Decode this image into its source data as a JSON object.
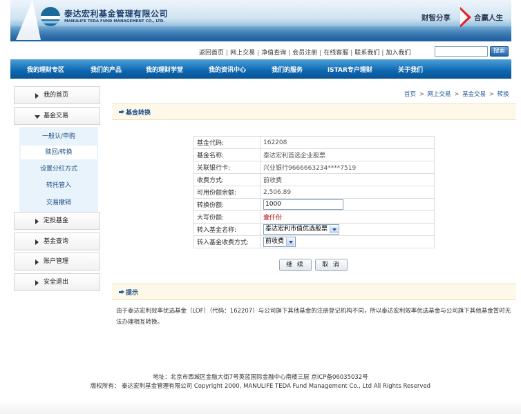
{
  "header": {
    "logo_cn": "泰达宏利基金管理有限公司",
    "logo_en": "MANULIFE TEDA FUND MANAGEMENT CO., LTD.",
    "slogan_left": "财智分享",
    "slogan_right": "合赢人生"
  },
  "toplinks": [
    "返回首页",
    "网上交易",
    "净值查询",
    "会员注册",
    "在线客服",
    "联系我们",
    "加入我们"
  ],
  "search": {
    "button": "搜索",
    "value": ""
  },
  "nav": [
    "我的理财专区",
    "我们的产品",
    "我的理财学堂",
    "我的资讯中心",
    "我们的服务",
    "iSTAR专户理财",
    "关于我们"
  ],
  "sidebar": {
    "items": [
      "我的首页",
      "基金交易",
      "定投基金",
      "基金查询",
      "账户管理",
      "安全退出"
    ],
    "sub_items": [
      "一般认/申购",
      "赎回/转换",
      "设置分红方式",
      "转托管入",
      "交易撤销"
    ]
  },
  "breadcrumb": [
    "首页",
    "网上交易",
    "基金交易",
    "转换"
  ],
  "section1_title": "基金转换",
  "form": {
    "rows": [
      {
        "label": "基金代码:",
        "value": "162208"
      },
      {
        "label": "基金名称:",
        "value": "泰达宏利首选企业股票"
      },
      {
        "label": "关联银行卡:",
        "value": "兴业银行9666663234****7519"
      },
      {
        "label": "收费方式:",
        "value": "前收费"
      },
      {
        "label": "可用份额余额:",
        "value": "2,506.89"
      },
      {
        "label": "转换份额:",
        "value": "1000"
      },
      {
        "label": "大写份额:",
        "value": "壹仟份"
      },
      {
        "label": "转入基金名称:",
        "value": "泰达宏利市值优选股票"
      },
      {
        "label": "转入基金收费方式:",
        "value": "前收费"
      }
    ]
  },
  "buttons": {
    "continue": "继 续",
    "cancel": "取 消"
  },
  "section2_title": "提示",
  "note": "由于泰达宏利效率优选基金（LOF）（代码：162207）与公司旗下其他基金的注册登记机构不同，所以泰达宏利效率优选基金与公司旗下其他基金暂时无法办理相互转换。",
  "footer": {
    "address": "地址：北京市西城区金融大街7号英蓝国际金融中心南楼三层 京ICP备06035032号",
    "copyright": "版权所有：  泰达宏利基金管理有限公司 Copyright 2000, MANULIFE TEDA Fund Management Co., Ltd All Rights Reserved"
  },
  "colors": {
    "nav_blue": "#0d66b0",
    "section_bg": "#fdf8e8",
    "red_text": "#b00000"
  }
}
